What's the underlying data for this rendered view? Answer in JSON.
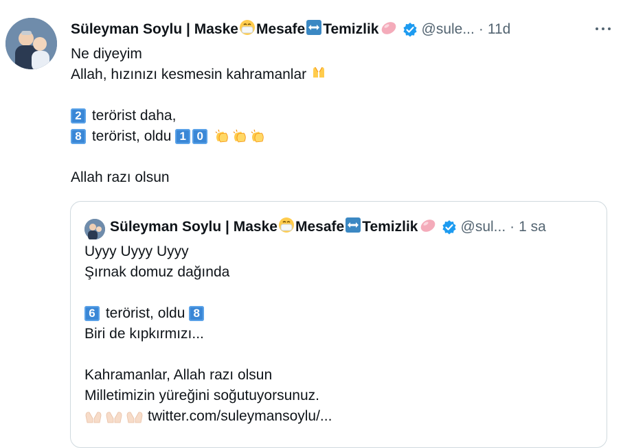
{
  "tweet": {
    "name_parts": [
      "Süleyman Soylu | Maske",
      " Mesafe",
      " Temizlik"
    ],
    "handle": "@sule...",
    "separator": "·",
    "time": "11d",
    "lines": [
      "Ne diyeyim",
      "Allah, hızınızı kesmesin kahramanlar",
      "",
      "terörist daha,",
      "terörist, oldu",
      "",
      "Allah razı olsun"
    ],
    "keycaps": {
      "two": "2",
      "eight": "8",
      "one": "1",
      "zero": "0"
    }
  },
  "quote": {
    "name_parts": [
      "Süleyman Soylu | Maske",
      " Mesafe",
      " Temizlik"
    ],
    "handle": "@sul...",
    "separator": "·",
    "time": "1 sa",
    "lines": [
      "Uyyy Uyyy Uyyy",
      "Şırnak domuz dağında",
      "",
      "terörist, oldu",
      "Biri de kıpkırmızı...",
      "",
      "Kahramanlar, Allah razı olsun",
      "Milletimizin yüreğini soğutuyorsunuz.",
      "twitter.com/suleymansoylu/..."
    ],
    "keycaps": {
      "six": "6",
      "eight": "8"
    }
  },
  "colors": {
    "text": "#0f1419",
    "secondary": "#536471",
    "verified": "#1d9bf0",
    "keycap": "#3a87d6",
    "border": "#cfd9de"
  },
  "icons": [
    "mask-face-icon",
    "left-right-arrow-icon",
    "soap-icon",
    "verified-badge-icon",
    "more-icon",
    "folded-hands-icon",
    "clapping-hands-icon",
    "keycap-icon"
  ]
}
